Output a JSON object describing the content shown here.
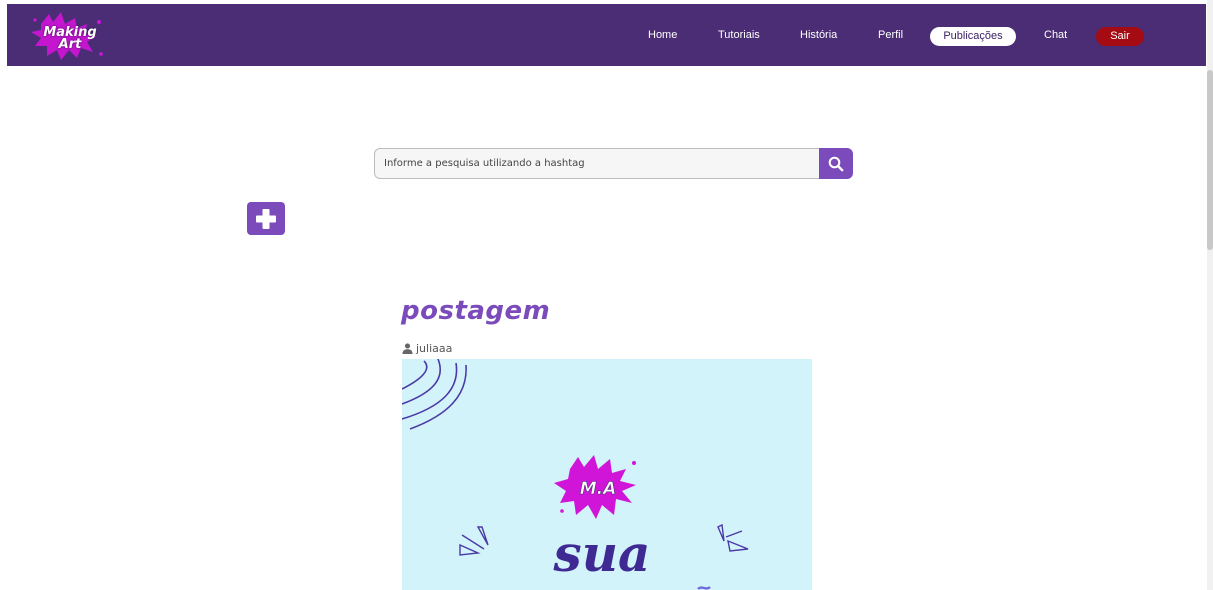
{
  "brand": {
    "logo_text_line1": "Making",
    "logo_text_line2": "Art"
  },
  "nav": {
    "home": "Home",
    "tutoriais": "Tutoriais",
    "historia": "História",
    "perfil": "Perfil",
    "publicacoes": "Publicações",
    "chat": "Chat",
    "sair": "Sair"
  },
  "search": {
    "placeholder": "Informe a pesquisa utilizando a hashtag",
    "value": ""
  },
  "icons": {
    "search": "search-icon",
    "add": "plus-icon",
    "user": "user-icon"
  },
  "post": {
    "title": "postagem",
    "author": "juliaaa",
    "image_text_badge": "M.A",
    "image_text_main": "sua"
  },
  "colors": {
    "navbar": "#4a2d74",
    "accent": "#7b4bbb",
    "logout": "#a50b12",
    "image_bg": "#d3f3fa",
    "splash": "#d014d8"
  }
}
